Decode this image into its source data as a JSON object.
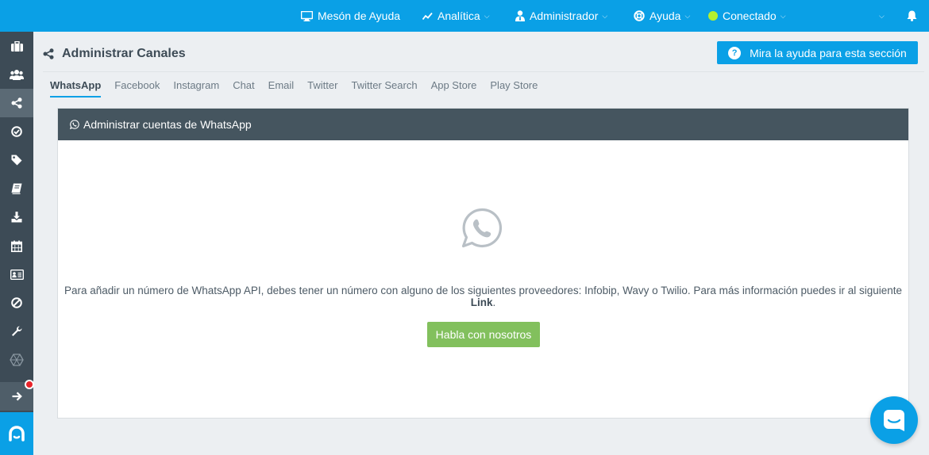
{
  "topbar": {
    "helpdesk": "Mesón de Ayuda",
    "analytics": "Analítica",
    "admin": "Administrador",
    "help": "Ayuda",
    "status": "Conectado",
    "status_color": "#b6f02e"
  },
  "colors": {
    "brand": "#0aa0e6",
    "sidebar": "#3d4b56",
    "panel_header": "#45555f",
    "success": "#82c05d",
    "notification": "#e8232a"
  },
  "sidebar": {
    "items": [
      "briefcase-icon",
      "users-icon",
      "share-icon",
      "check-circle-icon",
      "tag-icon",
      "book-icon",
      "download-icon",
      "calendar-icon",
      "id-card-icon",
      "ban-icon",
      "wrench-icon",
      "network-icon"
    ],
    "active": "share-icon"
  },
  "page": {
    "title": "Administrar Canales",
    "help_button": "Mira la ayuda para esta sección"
  },
  "tabs": [
    "WhatsApp",
    "Facebook",
    "Instagram",
    "Chat",
    "Email",
    "Twitter",
    "Twitter Search",
    "App Store",
    "Play Store"
  ],
  "active_tab": "WhatsApp",
  "panel": {
    "title": "Administrar cuentas de WhatsApp",
    "message": "Para añadir un número de WhatsApp API, debes tener un número con alguno de los siguientes proveedores: Infobip, Wavy o Twilio. Para más información puedes ir al siguiente",
    "link": "Link",
    "period": ".",
    "button": "Habla con nosotros"
  }
}
